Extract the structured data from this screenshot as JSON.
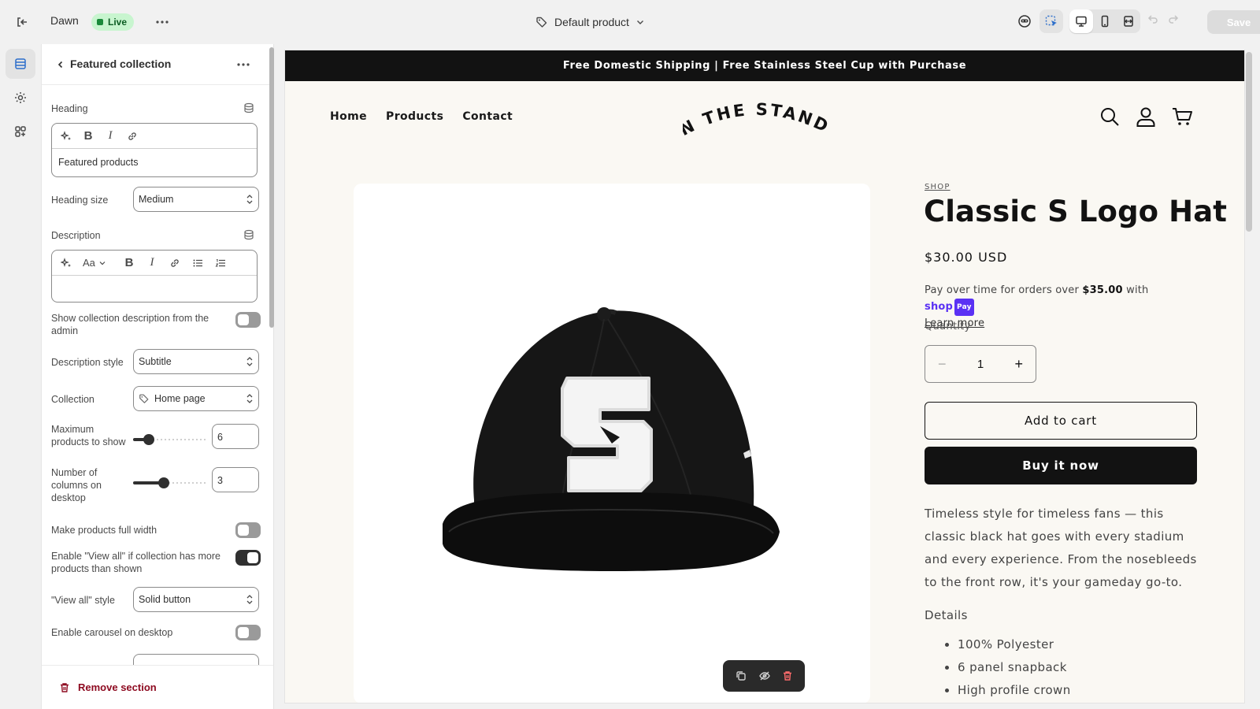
{
  "topbar": {
    "theme_name": "Dawn",
    "status_badge": "Live",
    "template_name": "Default product",
    "save_label": "Save"
  },
  "panel": {
    "title": "Featured collection",
    "heading_label": "Heading",
    "heading_value": "Featured products",
    "heading_size_label": "Heading size",
    "heading_size_value": "Medium",
    "description_label": "Description",
    "description_font_tool": "Aa",
    "show_desc_label": "Show collection description from the admin",
    "show_desc_on": false,
    "desc_style_label": "Description style",
    "desc_style_value": "Subtitle",
    "collection_label": "Collection",
    "collection_value": "Home page",
    "max_products_label": "Maximum products to show",
    "max_products_value": "6",
    "max_products_fraction": 0.22,
    "columns_label": "Number of columns on desktop",
    "columns_value": "3",
    "columns_fraction": 0.42,
    "full_width_label": "Make products full width",
    "full_width_on": false,
    "view_all_label": "Enable \"View all\" if collection has more products than shown",
    "view_all_on": true,
    "view_all_style_label": "\"View all\" style",
    "view_all_style_value": "Solid button",
    "carousel_label": "Enable carousel on desktop",
    "carousel_on": false,
    "remove_label": "Remove section"
  },
  "preview": {
    "announcement": "Free Domestic Shipping | Free Stainless Steel Cup with Purchase",
    "nav": [
      "Home",
      "Products",
      "Contact"
    ],
    "logo_text": "IN THE STANDS",
    "vendor": "SHOP",
    "product_title": "Classic S Logo Hat",
    "price": "$30.00 USD",
    "installments_prefix": "Pay over time for orders over",
    "installments_amount": "$35.00",
    "installments_with": "with",
    "shop_pay_word": "shop",
    "shop_pay_badge": "Pay",
    "learn_more": "Learn more",
    "quantity_label": "Quantity",
    "quantity_value": "1",
    "add_to_cart": "Add to cart",
    "buy_now": "Buy it now",
    "description": "Timeless style for timeless fans — this classic black hat goes with every stadium and every experience. From the nosebleeds to the front row, it's your gameday go-to.",
    "details_heading": "Details",
    "details": [
      "100% Polyester",
      "6 panel snapback",
      "High profile crown"
    ]
  },
  "colors": {
    "brand_dark": "#121212",
    "live_badge_bg": "#c8f5cf",
    "shop_pay": "#5a31f4",
    "danger": "#8e0b21",
    "preview_bg": "#faf8f3"
  }
}
